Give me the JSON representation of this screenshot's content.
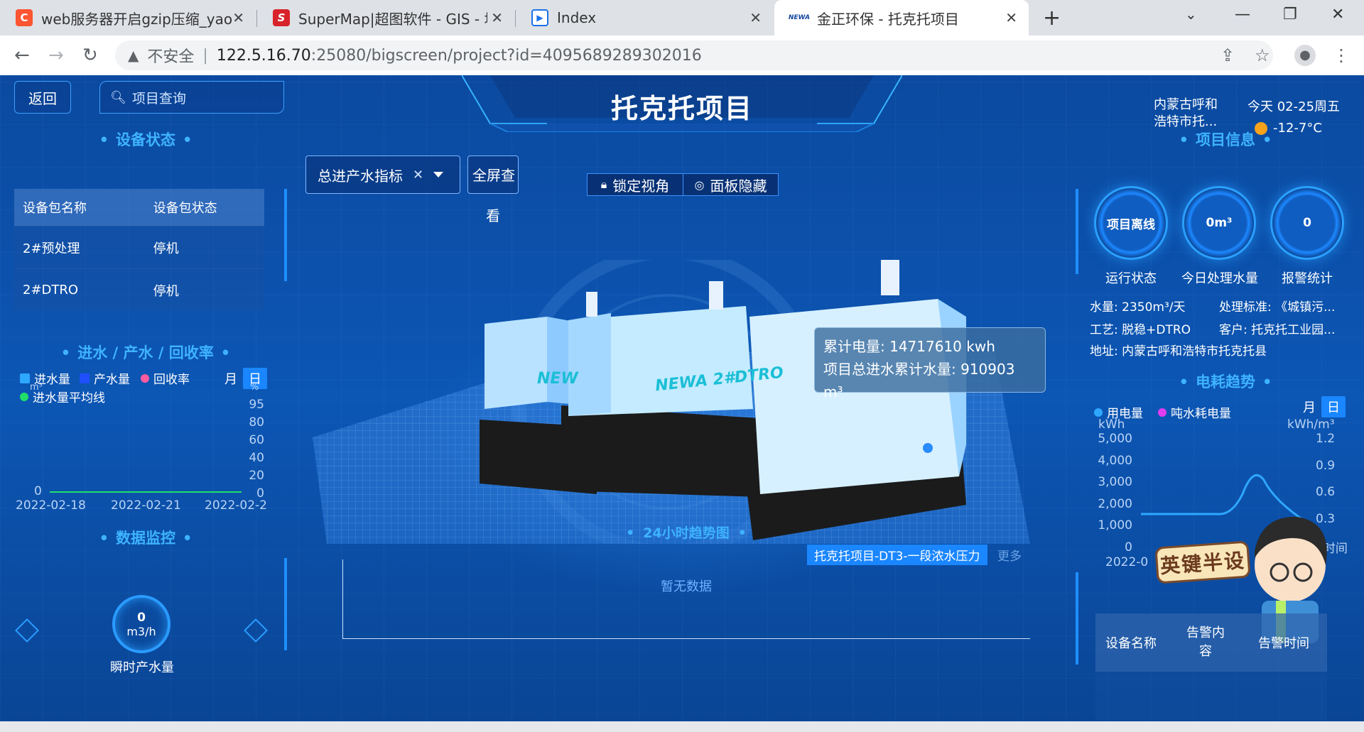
{
  "browser": {
    "tabs": [
      {
        "title": "web服务器开启gzip压缩_yaonian",
        "favicon": "C",
        "favicon_color": "#fc5531"
      },
      {
        "title": "SuperMap|超图软件 - GIS - 地理",
        "favicon": "S",
        "favicon_color": "#d8232a"
      },
      {
        "title": "Index",
        "favicon": "▶",
        "favicon_color": "#1a73e8"
      },
      {
        "title": "金正环保 - 托克托项目",
        "favicon": "NEWA",
        "favicon_color": "#ffffff",
        "active": true
      }
    ],
    "security_label": "不安全",
    "url_host": "122.5.16.70",
    "url_rest": ":25080/bigscreen/project?id=4095689289302016"
  },
  "header": {
    "title": "托克托项目",
    "back_label": "返回",
    "search_placeholder": "项目查询",
    "location": "内蒙古呼和浩特市托...",
    "date": "今天 02-25周五",
    "temperature": "-12-7°C",
    "weather_icon": "sun-icon"
  },
  "device_status": {
    "title": "设备状态",
    "columns": [
      "设备包名称",
      "设备包状态"
    ],
    "rows": [
      {
        "name": "2#预处理",
        "status": "停机"
      },
      {
        "name": "2#DTRO",
        "status": "停机"
      }
    ]
  },
  "water_chart": {
    "title": "进水 / 产水 / 回收率",
    "toggle": [
      "月",
      "日"
    ],
    "toggle_active": "日",
    "legend": [
      {
        "label": "进水量",
        "color": "#2ea7ff",
        "shape": "square"
      },
      {
        "label": "产水量",
        "color": "#1f4fff",
        "shape": "square"
      },
      {
        "label": "回收率",
        "color": "#ff5b9e",
        "shape": "dot"
      },
      {
        "label": "进水量平均线",
        "color": "#21e06a",
        "shape": "dot"
      }
    ],
    "y_left_unit": "m³",
    "y_right_unit": "%",
    "y_left_ticks": [
      "0"
    ],
    "y_right_ticks": [
      "95",
      "80",
      "60",
      "40",
      "20",
      "0"
    ],
    "x_ticks": [
      "2022-02-18",
      "2022-02-21",
      "2022-02-2"
    ]
  },
  "data_monitor": {
    "title": "数据监控",
    "value": "0",
    "unit": "m3/h",
    "label": "瞬时产水量"
  },
  "center": {
    "indicator_select": "总进产水指标",
    "fullscreen_label": "全屏查看",
    "lock_view": "锁定视角",
    "hide_panel": "面板隐藏",
    "tooltip_power": "累计电量: 14717610 kwh",
    "tooltip_water": "项目总进水累计水量: 910903 m³",
    "container_label_1": "NEW",
    "container_label_2": "NEWA 2#DTRO"
  },
  "trend": {
    "title": "24小时趋势图",
    "chip": "托克托项目-DT3-一段浓水压力",
    "more": "更多",
    "empty": "暂无数据"
  },
  "project_info": {
    "title": "项目信息",
    "stats": [
      {
        "value": "项目离线",
        "label": "运行状态"
      },
      {
        "value": "0m³",
        "label": "今日处理水量"
      },
      {
        "value": "0",
        "label": "报警统计"
      }
    ],
    "water": "水量: 2350m³/天",
    "standard": "处理标准: 《城镇污...",
    "process": "工艺: 脱稳+DTRO",
    "client": "客户: 托克托工业园...",
    "address": "地址: 内蒙古呼和浩特市托克托县"
  },
  "power_chart": {
    "title": "电耗趋势",
    "toggle": [
      "月",
      "日"
    ],
    "toggle_active": "日",
    "legend": [
      {
        "label": "用电量",
        "color": "#2ea7ff"
      },
      {
        "label": "吨水耗电量",
        "color": "#e23cf0"
      }
    ],
    "y_left_unit": "kWh",
    "y_right_unit": "kWh/m³",
    "y_left_ticks": [
      "5,000",
      "4,000",
      "3,000",
      "2,000",
      "1,000",
      "0"
    ],
    "y_right_ticks": [
      "1.2",
      "0.9",
      "0.6",
      "0.3",
      "0时间"
    ],
    "x_tick": "2022-0"
  },
  "alarm_table": {
    "columns": [
      "设备名称",
      "告警内容",
      "告警时间"
    ]
  },
  "sticker_text": "英键半设"
}
